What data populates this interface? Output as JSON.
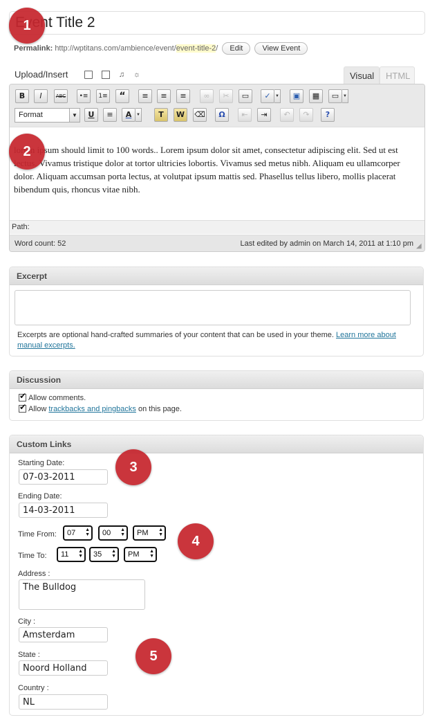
{
  "post": {
    "title": "Event Title 2",
    "permalink_label": "Permalink:",
    "permalink_base": "http://wptitans.com/ambience/event/",
    "permalink_slug": "event-title-2",
    "permalink_trail": "/",
    "edit_label": "Edit",
    "view_label": "View Event"
  },
  "upload": {
    "label": "Upload/Insert"
  },
  "editor_tabs": {
    "visual": "Visual",
    "html": "HTML"
  },
  "toolbar": {
    "row1": [
      "B",
      "I",
      "ABC",
      "•≡",
      "1≡",
      "“",
      "≡",
      "≡",
      "≡",
      "∞",
      "✂",
      "▭",
      "✓",
      "▣",
      "▦",
      "▭"
    ],
    "format_label": "Format",
    "row2": [
      "U",
      "≡",
      "A",
      "T",
      "W",
      "⌫",
      "Ω",
      "⇤",
      "⇥",
      "↶",
      "↷",
      "?"
    ]
  },
  "content": {
    "body": "lorem ipsum should limit to 100 words..  Lorem ipsum dolor sit amet, consectetur adipiscing elit. Sed ut est lectus. Vivamus tristique dolor at tortor ultricies lobortis. Vivamus sed metus nibh. Aliquam eu ullamcorper dolor. Aliquam accumsan porta lectus, at volutpat ipsum mattis sed. Phasellus tellus libero, mollis placerat bibendum quis, rhoncus vitae nibh."
  },
  "status": {
    "path_label": "Path:",
    "word_count": "Word count: 52",
    "last_edited": "Last edited by admin on March 14, 2011 at 1:10 pm"
  },
  "excerpt": {
    "heading": "Excerpt",
    "value": "",
    "help_text": "Excerpts are optional hand-crafted summaries of your content that can be used in your theme. ",
    "help_link": "Learn more about manual excerpts."
  },
  "discussion": {
    "heading": "Discussion",
    "allow_comments": "Allow comments.",
    "allow_prefix": "Allow ",
    "trackbacks_link": "trackbacks and pingbacks",
    "allow_suffix": " on this page."
  },
  "custom_links": {
    "heading": "Custom Links",
    "start_label": "Starting Date:",
    "start_value": "07-03-2011",
    "end_label": "Ending Date:",
    "end_value": "14-03-2011",
    "time_from_label": "Time From:",
    "time_from": {
      "hour": "07",
      "minute": "00",
      "ampm": "PM"
    },
    "time_to_label": "Time To:",
    "time_to": {
      "hour": "11",
      "minute": "35",
      "ampm": "PM"
    },
    "address_label": "Address :",
    "address_value": "The Bulldog",
    "city_label": "City :",
    "city_value": "Amsterdam",
    "state_label": "State :",
    "state_value": "Noord Holland",
    "country_label": "Country :",
    "country_value": "NL"
  },
  "markers": [
    "1",
    "2",
    "3",
    "4",
    "5"
  ],
  "colors": {
    "marker": "#c6262e",
    "link": "#21759b",
    "slug_highlight": "#fffbcc"
  }
}
